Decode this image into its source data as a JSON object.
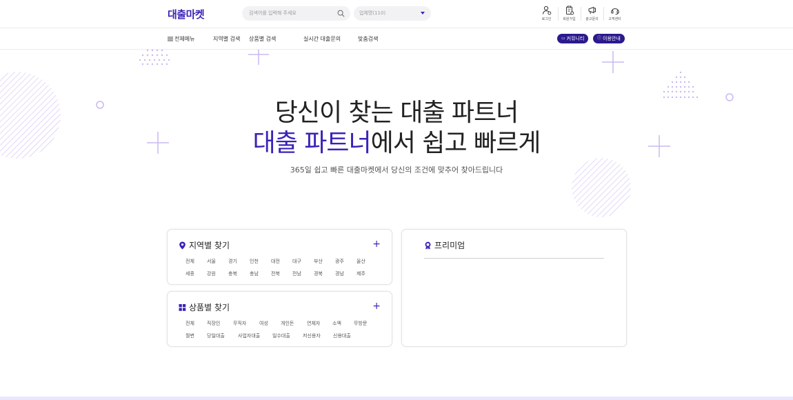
{
  "header": {
    "logo": "대출마켓",
    "search": {
      "placeholder": "검색어를 입력해 주세요"
    },
    "region_select": {
      "value": "업체명(110)"
    },
    "utils": [
      {
        "label": "로그인",
        "icon": "user-icon"
      },
      {
        "label": "회원가입",
        "icon": "clipboard-icon"
      },
      {
        "label": "광고문의",
        "icon": "megaphone-icon"
      },
      {
        "label": "고객센터",
        "icon": "headset-icon"
      }
    ]
  },
  "nav": {
    "menu_label": "전체메뉴",
    "items": [
      "지역별 검색",
      "상품별 검색",
      "실시간 대출문의",
      "맞춤검색"
    ],
    "community_label": "커뮤니티",
    "guide_label": "이용안내"
  },
  "hero": {
    "line1": "당신이 찾는 대출 파트너",
    "line2_accent": "대출 파트너",
    "line2_rest": "에서 쉽고 빠르게",
    "subtitle": "365일 쉽고 빠른 대출마켓에서 당신의 조건에 맞추어 찾아드립니다"
  },
  "region_card": {
    "title": "지역별 찾기",
    "row1": [
      "전체",
      "서울",
      "경기",
      "인천",
      "대전",
      "대구",
      "부산",
      "광주",
      "울산"
    ],
    "row2": [
      "세종",
      "강원",
      "충북",
      "충남",
      "전북",
      "전남",
      "경북",
      "경남",
      "제주"
    ]
  },
  "product_card": {
    "title": "상품별 찾기",
    "row1": [
      "전체",
      "직장인",
      "무직자",
      "여성",
      "개인돈",
      "연체자",
      "소액",
      "무방문"
    ],
    "row2": [
      "월변",
      "당일대출",
      "사업자대출",
      "일수대출",
      "저신용자",
      "신용대출"
    ]
  },
  "premium_card": {
    "title": "프리미엄"
  },
  "colors": {
    "brand": "#3b22b7",
    "pill": "#2a1a8c",
    "deco": "#c9b8f2"
  }
}
